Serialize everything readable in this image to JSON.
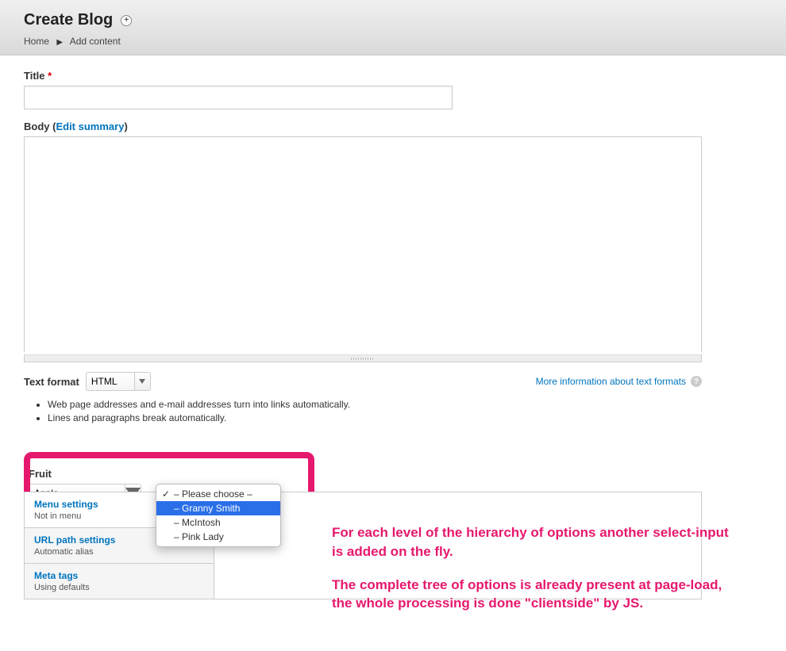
{
  "header": {
    "title": "Create Blog",
    "breadcrumb": {
      "home": "Home",
      "add_content": "Add content"
    }
  },
  "form": {
    "title_label": "Title",
    "body_label": "Body",
    "edit_summary": "Edit summary",
    "text_format_label": "Text format",
    "text_format_value": "HTML",
    "more_info": "More information about text formats",
    "tip1": "Web page addresses and e-mail addresses turn into links automatically.",
    "tip2": "Lines and paragraphs break automatically."
  },
  "fruit": {
    "label": "Fruit",
    "selected": "Apple",
    "options": [
      {
        "label": "– Please choose –",
        "checked": true,
        "selected": false
      },
      {
        "label": "– Granny Smith",
        "checked": false,
        "selected": true
      },
      {
        "label": "– McIntosh",
        "checked": false,
        "selected": false
      },
      {
        "label": "– Pink Lady",
        "checked": false,
        "selected": false
      }
    ]
  },
  "vtabs": [
    {
      "title": "Menu settings",
      "sub": "Not in menu",
      "active": true
    },
    {
      "title": "URL path settings",
      "sub": "Automatic alias",
      "active": false
    },
    {
      "title": "Meta tags",
      "sub": "Using defaults",
      "active": false
    }
  ],
  "annotation": {
    "p1": "For each level of the hierarchy of options another select-input is added on the fly.",
    "p2": "The complete tree of options is already present at page-load, the whole processing is done \"clientside\" by JS."
  }
}
